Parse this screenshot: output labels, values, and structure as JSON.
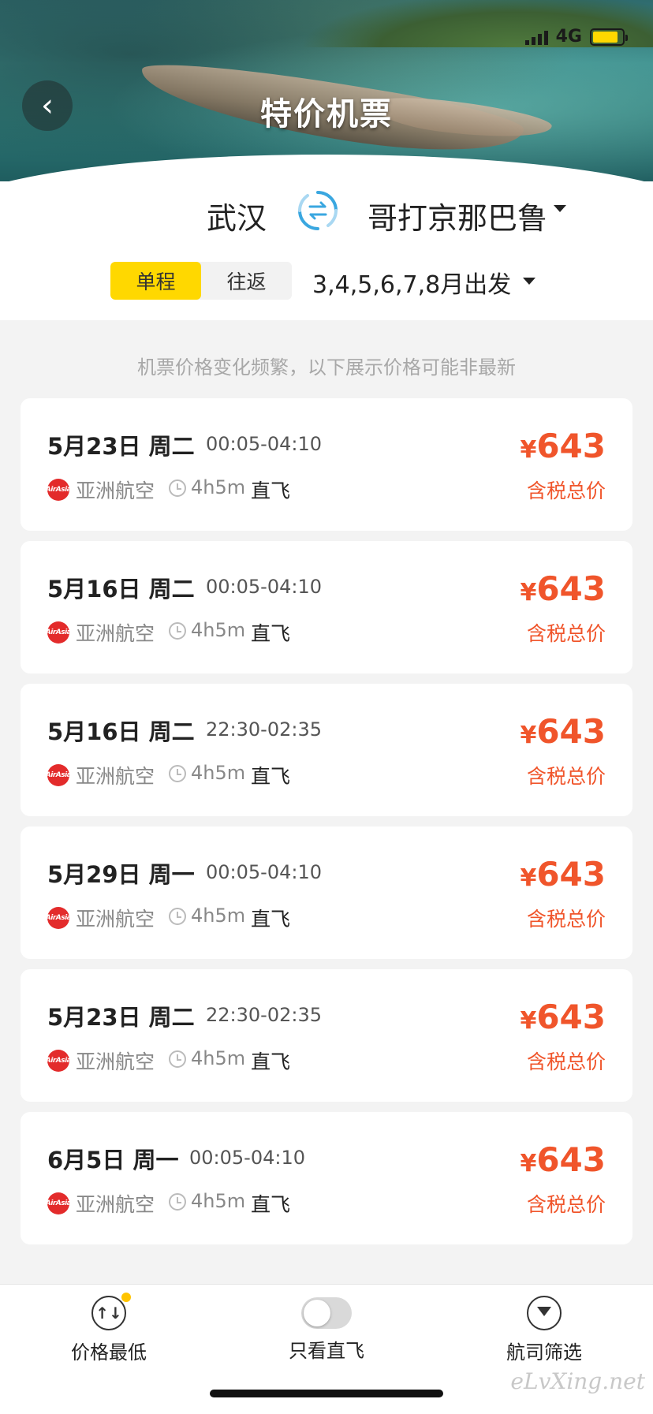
{
  "status": {
    "network": "4G",
    "battery_level": 0.85,
    "battery_color": "#ffd800"
  },
  "header": {
    "title": "特价机票",
    "back_icon": "chevron-left-icon"
  },
  "route": {
    "origin": "武汉",
    "destination": "哥打京那巴鲁",
    "swap_icon": "swap-arrows-icon"
  },
  "trip_type": {
    "options": [
      "单程",
      "往返"
    ],
    "selected": "单程"
  },
  "depart_filter": "3,4,5,6,7,8月出发",
  "notice": "机票价格变化频繁，以下展示价格可能非最新",
  "flights": [
    {
      "date": "5月23日 周二",
      "time": "00:05-04:10",
      "airline": "亚洲航空",
      "airline_logo_text": "AirAsia",
      "duration": "4h5m",
      "direct": "直飞",
      "currency": "¥",
      "price": "643",
      "price_note": "含税总价"
    },
    {
      "date": "5月16日 周二",
      "time": "00:05-04:10",
      "airline": "亚洲航空",
      "airline_logo_text": "AirAsia",
      "duration": "4h5m",
      "direct": "直飞",
      "currency": "¥",
      "price": "643",
      "price_note": "含税总价"
    },
    {
      "date": "5月16日 周二",
      "time": "22:30-02:35",
      "airline": "亚洲航空",
      "airline_logo_text": "AirAsia",
      "duration": "4h5m",
      "direct": "直飞",
      "currency": "¥",
      "price": "643",
      "price_note": "含税总价"
    },
    {
      "date": "5月29日 周一",
      "time": "00:05-04:10",
      "airline": "亚洲航空",
      "airline_logo_text": "AirAsia",
      "duration": "4h5m",
      "direct": "直飞",
      "currency": "¥",
      "price": "643",
      "price_note": "含税总价"
    },
    {
      "date": "5月23日 周二",
      "time": "22:30-02:35",
      "airline": "亚洲航空",
      "airline_logo_text": "AirAsia",
      "duration": "4h5m",
      "direct": "直飞",
      "currency": "¥",
      "price": "643",
      "price_note": "含税总价"
    },
    {
      "date": "6月5日 周一",
      "time": "00:05-04:10",
      "airline": "亚洲航空",
      "airline_logo_text": "AirAsia",
      "duration": "4h5m",
      "direct": "直飞",
      "currency": "¥",
      "price": "643",
      "price_note": "含税总价"
    }
  ],
  "bottom_bar": {
    "sort": {
      "label": "价格最低",
      "icon": "sort-arrows-icon",
      "sort_icon_text": "↑↓"
    },
    "direct_only": {
      "label": "只看直飞",
      "enabled": false
    },
    "airline_filter": {
      "label": "航司筛选",
      "icon": "filter-funnel-icon"
    }
  },
  "watermark": "eLvXing.net",
  "colors": {
    "accent": "#ffd800",
    "price": "#f0552b",
    "swap_icon": "#3aa7e0"
  }
}
